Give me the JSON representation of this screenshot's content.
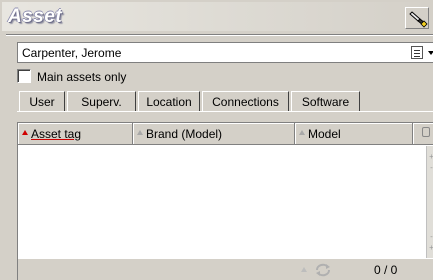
{
  "window": {
    "title": "Asset"
  },
  "user_field": {
    "value": "Carpenter, Jerome"
  },
  "filter": {
    "label": "Main assets only",
    "checked": false
  },
  "tabs": [
    {
      "label": "User"
    },
    {
      "label": "Superv."
    },
    {
      "label": "Location"
    },
    {
      "label": "Connections"
    },
    {
      "label": "Software"
    }
  ],
  "table": {
    "columns": [
      {
        "label": "Asset tag",
        "sorted": true
      },
      {
        "label": "Brand (Model)",
        "sorted": false
      },
      {
        "label": "Model",
        "sorted": false
      }
    ],
    "rows": []
  },
  "status": {
    "counter": "0 / 0"
  },
  "icons": {
    "title": "flashlight-icon",
    "combo": "list-icon",
    "status": "refresh-icon"
  },
  "colors": {
    "sort_active": "#d00000",
    "title_shadow": "#6f6f8a",
    "face": "#d4d0c8"
  }
}
